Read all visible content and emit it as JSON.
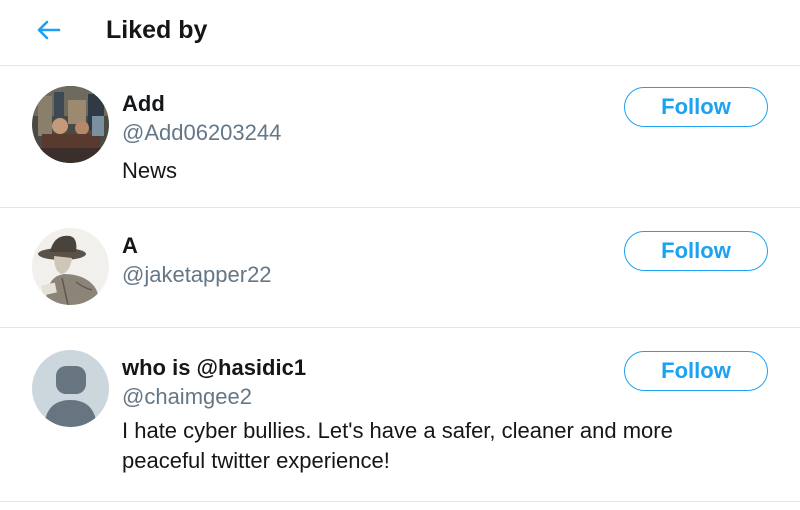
{
  "header": {
    "title": "Liked by",
    "back_icon": "back-arrow-icon",
    "accent_color": "#1da1f2"
  },
  "users": [
    {
      "display_name": "Add",
      "handle": "@Add06203244",
      "bio": "News",
      "follow_label": "Follow",
      "avatar": "photo-avatar"
    },
    {
      "display_name": "A",
      "handle": "@jaketapper22",
      "bio": "",
      "follow_label": "Follow",
      "avatar": "sketch-avatar"
    },
    {
      "display_name": "who is @hasidic1",
      "handle": "@chaimgee2",
      "bio": "I hate cyber bullies. Let's have a safer, cleaner and more peaceful twitter experience!",
      "follow_label": "Follow",
      "avatar": "default-avatar"
    }
  ]
}
